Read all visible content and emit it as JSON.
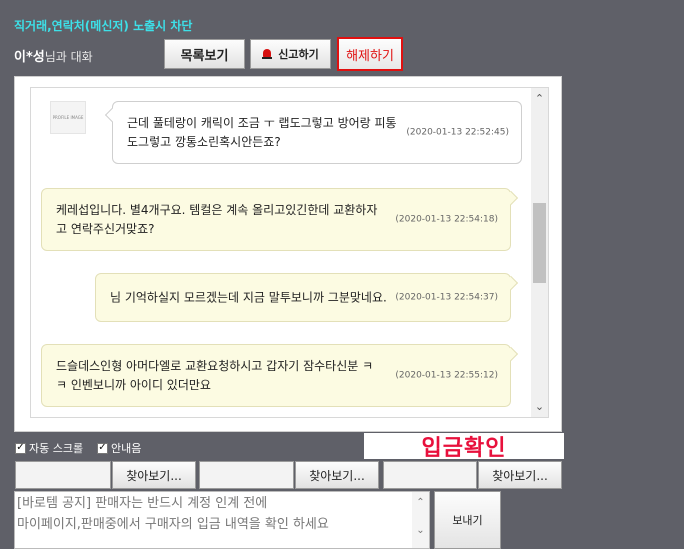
{
  "header": {
    "warning": "직거래,연락처(메신저) 노출시 차단",
    "partner_name": "이*성",
    "partner_suffix": "님과 대화"
  },
  "toolbar": {
    "list_label": "목록보기",
    "report_label": "신고하기",
    "unblock_label": "해제하기"
  },
  "chat": {
    "avatar_text": "PROFILE IMAGE",
    "messages": [
      {
        "side": "in",
        "text_lines": [
          "근데 풀테랑이 캐릭이 조금 ㅜ 랩도그렇고 방어랑 피통",
          "도그렇고 깡통소린혹시안든죠?"
        ],
        "time": "(2020-01-13 22:52:45)"
      },
      {
        "side": "out",
        "text_lines": [
          "케레섭입니다. 별4개구요. 템컬은 계속 올리고있긴한데 교환하자",
          "고 연락주신거맞죠?"
        ],
        "time": "(2020-01-13 22:54:18)"
      },
      {
        "side": "out",
        "text_lines": [
          "님 기억하실지 모르겠는데 지금 말투보니까 그분맞네요."
        ],
        "time": "(2020-01-13 22:54:37)"
      },
      {
        "side": "out",
        "text_lines": [
          "드슬데스인형 아머다엘로 교환요청하시고 갑자기 잠수타신분 ㅋ",
          "ㅋ 인벤보니까 아이디 있더만요"
        ],
        "time": "(2020-01-13 22:55:12)"
      }
    ]
  },
  "options": {
    "autoscroll_label": "자동 스크롤",
    "guide_label": "안내음",
    "autoscroll_checked": true,
    "guide_checked": true
  },
  "deposit_label": "입금확인",
  "files": {
    "browse_label": "찾아보기..."
  },
  "composer": {
    "placeholder_line1": "[바로템 공지] 판매자는 반드시 계정 인계 전에",
    "placeholder_line2": "마이페이지,판매중에서 구매자의 입금 내역을 확인 하세요",
    "send_label": "보내기"
  },
  "colors": {
    "background": "#5f6068",
    "warning_text": "#3de0e8",
    "unblock_red": "#e01010",
    "deposit_red": "#e8103c",
    "outgoing_bubble": "#fcfbe2"
  },
  "icons": {
    "report": "bell-icon",
    "scroll_up": "chevron-up-icon",
    "scroll_down": "chevron-down-icon",
    "check": "check-icon"
  }
}
